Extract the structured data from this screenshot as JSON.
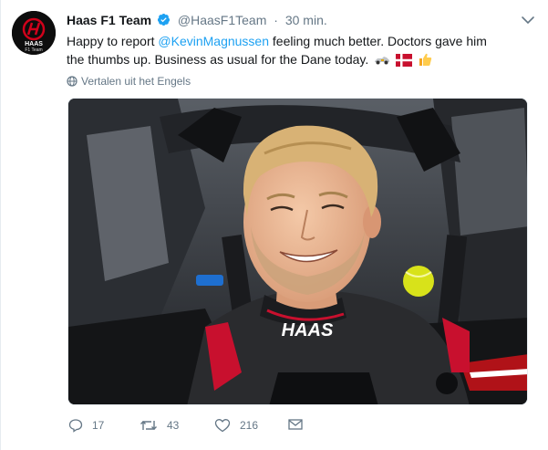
{
  "tweet": {
    "author_name": "Haas F1 Team",
    "author_handle": "@HaasF1Team",
    "separator": "·",
    "time": "30 min.",
    "avatar_text_top": "HAAS",
    "avatar_text_bottom": "F1 Team",
    "text_before": "Happy to report ",
    "mention": "@KevinMagnussen",
    "text_after": " feeling much better. Doctors gave him the thumbs up. Business as usual for the Dane today.",
    "translate_label": "Vertalen uit het Engels",
    "car_branding": "HAAS"
  },
  "actions": {
    "replies": "17",
    "retweets": "43",
    "likes": "216"
  },
  "colors": {
    "accent": "#1da1f2",
    "muted": "#657786",
    "haas_red": "#d0021b"
  }
}
